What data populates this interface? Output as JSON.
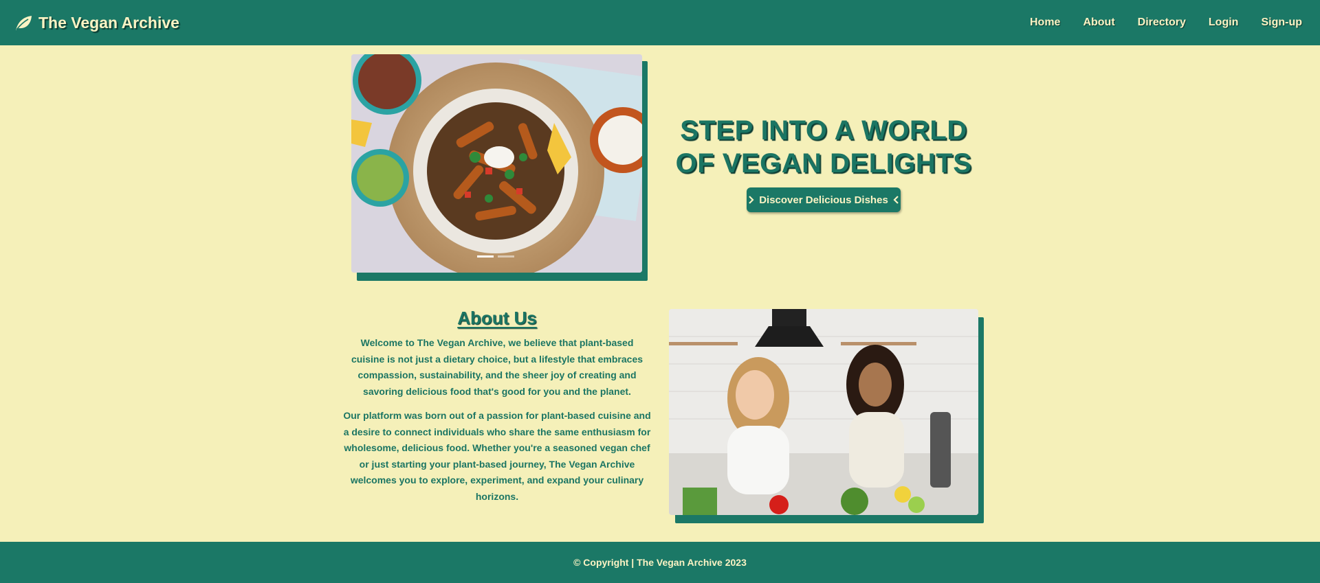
{
  "navbar": {
    "brand_icon": "leaf-icon",
    "brand": "The Vegan Archive",
    "links": [
      "Home",
      "About",
      "Directory",
      "Login",
      "Sign-up"
    ]
  },
  "hero": {
    "heading_line1": "STEP INTO A WORLD",
    "heading_line2": "OF VEGAN DELIGHTS",
    "cta_label": "Discover Delicious Dishes",
    "carousel_slides": 2,
    "carousel_active": 1
  },
  "about": {
    "title": "About Us",
    "p1": "Welcome to The Vegan Archive, we believe that plant-based cuisine is not just a dietary choice, but a lifestyle that embraces compassion, sustainability, and the sheer joy of creating and savoring delicious food that's good for you and the planet.",
    "p2": "Our platform was born out of a passion for plant-based cuisine and a desire to connect individuals who share the same enthusiasm for wholesome, delicious food. Whether you're a seasoned vegan chef or just starting your plant-based journey, The Vegan Archive welcomes you to explore, experiment, and expand your culinary horizons."
  },
  "footer": {
    "text": "© Copyright | The Vegan Archive 2023"
  },
  "colors": {
    "primary": "#1b7866",
    "background": "#f5f0b9",
    "light_text": "#fbf3c4"
  }
}
